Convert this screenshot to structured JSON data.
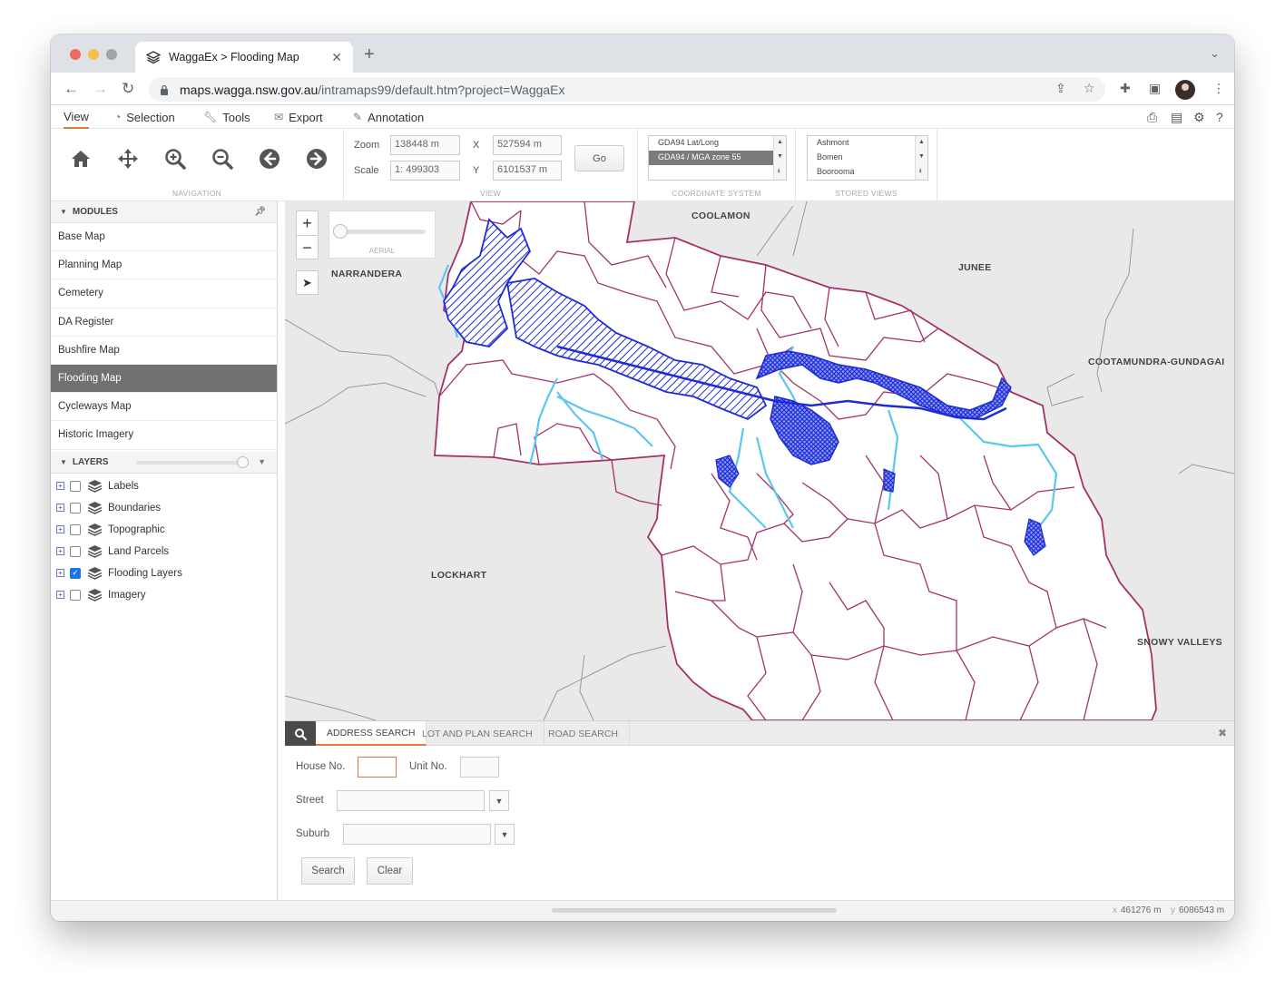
{
  "browser": {
    "tab_title": "WaggaEx > Flooding Map",
    "new_tab_glyph": "+",
    "url_host": "maps.wagga.nsw.gov.au",
    "url_path": "/intramaps99/default.htm?project=WaggaEx"
  },
  "menu": {
    "items": [
      "View",
      "Selection",
      "Tools",
      "Export",
      "Annotation"
    ],
    "icons": [
      "",
      "circle-arrow-icon",
      "wrench-icon",
      "envelope-icon",
      "pencil-icon"
    ],
    "active": "View"
  },
  "ribbon": {
    "navigation_caption": "NAVIGATION",
    "view_caption": "VIEW",
    "coordinate_caption": "COORDINATE SYSTEM",
    "stored_caption": "STORED VIEWS",
    "zoom_label": "Zoom",
    "zoom_value": "138448 m",
    "scale_label": "Scale",
    "scale_value": "1: 499303",
    "x_label": "X",
    "x_value": "527594 m",
    "y_label": "Y",
    "y_value": "6101537 m",
    "go_label": "Go",
    "coordinate_systems": [
      "GDA94 Lat/Long",
      "GDA94 / MGA zone 55"
    ],
    "coordinate_selected": 1,
    "stored_views": [
      "Ashmont",
      "Bomen",
      "Boorooma"
    ]
  },
  "sidebar": {
    "modules_title": "MODULES",
    "modules": [
      "Base Map",
      "Planning Map",
      "Cemetery",
      "DA Register",
      "Bushfire Map",
      "Flooding Map",
      "Cycleways Map",
      "Historic Imagery"
    ],
    "active_module": "Flooding Map",
    "layers_title": "LAYERS",
    "layers": [
      {
        "label": "Labels",
        "checked": false
      },
      {
        "label": "Boundaries",
        "checked": false
      },
      {
        "label": "Topographic",
        "checked": false
      },
      {
        "label": "Land Parcels",
        "checked": false
      },
      {
        "label": "Flooding Layers",
        "checked": true
      },
      {
        "label": "Imagery",
        "checked": false
      }
    ]
  },
  "map": {
    "place_labels": [
      "COOLAMON",
      "JUNEE",
      "NARRANDERA",
      "COOTAMUNDRA-GUNDAGAI",
      "LOCKHART",
      "SNOWY VALLEYS"
    ],
    "aerial_caption": "AERIAL",
    "zoom_in": "+",
    "zoom_out": "−",
    "colors": {
      "background": "#e9e9e9",
      "boundary": "#a3326a",
      "flood": "#1d2bd8",
      "river": "#5bc6ee"
    }
  },
  "search": {
    "tabs": [
      "ADDRESS SEARCH",
      "LOT AND PLAN SEARCH",
      "ROAD SEARCH"
    ],
    "active_tab": 0,
    "house_label": "House No.",
    "unit_label": "Unit No.",
    "street_label": "Street",
    "suburb_label": "Suburb",
    "search_button": "Search",
    "clear_button": "Clear",
    "close_glyph": "✖"
  },
  "status": {
    "x_axis": "x",
    "x_value": "461276 m",
    "y_axis": "y",
    "y_value": "6086543 m"
  }
}
